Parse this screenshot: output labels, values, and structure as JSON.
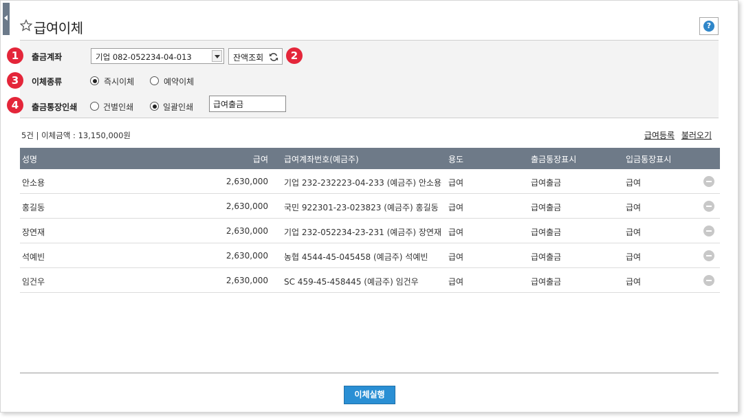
{
  "header": {
    "title": "급여이체",
    "help_label": "?"
  },
  "form": {
    "account": {
      "badge": "1",
      "label": "출금계좌",
      "value": "기업  082-052234-04-013",
      "balance_button": "잔액조회",
      "balance_badge": "2"
    },
    "transfer_type": {
      "badge": "3",
      "label": "이체종류",
      "options": [
        "즉시이체",
        "예약이체"
      ],
      "selected": "즉시이체"
    },
    "passbook_print": {
      "badge": "4",
      "label": "출금통장인쇄",
      "options": [
        "건별인쇄",
        "일괄인쇄"
      ],
      "selected": "일괄인쇄",
      "memo": "급여출금"
    }
  },
  "summary": "5건 | 이체금액 : 13,150,000원",
  "links": {
    "register": "급여등록",
    "load": "불러오기"
  },
  "table": {
    "columns": [
      "성명",
      "급여",
      "급여계좌번호(예금주)",
      "용도",
      "출금통장표시",
      "입금통장표시"
    ],
    "rows": [
      {
        "name": "안소용",
        "amount": "2,630,000",
        "account": "기업 232-232223-04-233 (예금주) 안소용",
        "use": "급여",
        "out": "급여출금",
        "in": "급여"
      },
      {
        "name": "홍길동",
        "amount": "2,630,000",
        "account": "국민 922301-23-023823 (예금주) 홍길동",
        "use": "급여",
        "out": "급여출금",
        "in": "급여"
      },
      {
        "name": "장연재",
        "amount": "2,630,000",
        "account": "기업 232-052234-23-231 (예금주) 장연재",
        "use": "급여",
        "out": "급여출금",
        "in": "급여"
      },
      {
        "name": "석예빈",
        "amount": "2,630,000",
        "account": "농협 4544-45-045458 (예금주) 석예빈",
        "use": "급여",
        "out": "급여출금",
        "in": "급여"
      },
      {
        "name": "임건우",
        "amount": "2,630,000",
        "account": "SC 459-45-458445 (예금주) 임건우",
        "use": "급여",
        "out": "급여출금",
        "in": "급여"
      }
    ]
  },
  "execute_button": "이체실행",
  "colors": {
    "accent": "#2a8fd4",
    "badge": "#e4263a",
    "table_header": "#6e7a88"
  }
}
